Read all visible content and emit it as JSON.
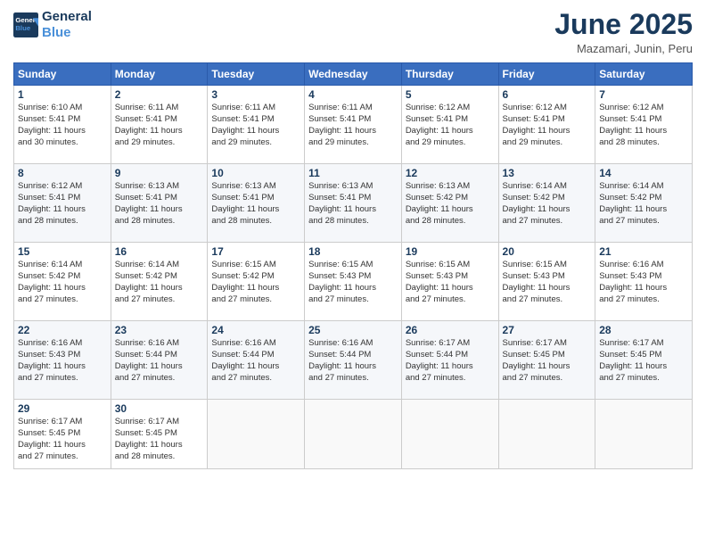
{
  "header": {
    "logo_line1": "General",
    "logo_line2": "Blue",
    "month": "June 2025",
    "location": "Mazamari, Junin, Peru"
  },
  "weekdays": [
    "Sunday",
    "Monday",
    "Tuesday",
    "Wednesday",
    "Thursday",
    "Friday",
    "Saturday"
  ],
  "weeks": [
    [
      {
        "day": "1",
        "info": "Sunrise: 6:10 AM\nSunset: 5:41 PM\nDaylight: 11 hours\nand 30 minutes."
      },
      {
        "day": "2",
        "info": "Sunrise: 6:11 AM\nSunset: 5:41 PM\nDaylight: 11 hours\nand 29 minutes."
      },
      {
        "day": "3",
        "info": "Sunrise: 6:11 AM\nSunset: 5:41 PM\nDaylight: 11 hours\nand 29 minutes."
      },
      {
        "day": "4",
        "info": "Sunrise: 6:11 AM\nSunset: 5:41 PM\nDaylight: 11 hours\nand 29 minutes."
      },
      {
        "day": "5",
        "info": "Sunrise: 6:12 AM\nSunset: 5:41 PM\nDaylight: 11 hours\nand 29 minutes."
      },
      {
        "day": "6",
        "info": "Sunrise: 6:12 AM\nSunset: 5:41 PM\nDaylight: 11 hours\nand 29 minutes."
      },
      {
        "day": "7",
        "info": "Sunrise: 6:12 AM\nSunset: 5:41 PM\nDaylight: 11 hours\nand 28 minutes."
      }
    ],
    [
      {
        "day": "8",
        "info": "Sunrise: 6:12 AM\nSunset: 5:41 PM\nDaylight: 11 hours\nand 28 minutes."
      },
      {
        "day": "9",
        "info": "Sunrise: 6:13 AM\nSunset: 5:41 PM\nDaylight: 11 hours\nand 28 minutes."
      },
      {
        "day": "10",
        "info": "Sunrise: 6:13 AM\nSunset: 5:41 PM\nDaylight: 11 hours\nand 28 minutes."
      },
      {
        "day": "11",
        "info": "Sunrise: 6:13 AM\nSunset: 5:41 PM\nDaylight: 11 hours\nand 28 minutes."
      },
      {
        "day": "12",
        "info": "Sunrise: 6:13 AM\nSunset: 5:42 PM\nDaylight: 11 hours\nand 28 minutes."
      },
      {
        "day": "13",
        "info": "Sunrise: 6:14 AM\nSunset: 5:42 PM\nDaylight: 11 hours\nand 27 minutes."
      },
      {
        "day": "14",
        "info": "Sunrise: 6:14 AM\nSunset: 5:42 PM\nDaylight: 11 hours\nand 27 minutes."
      }
    ],
    [
      {
        "day": "15",
        "info": "Sunrise: 6:14 AM\nSunset: 5:42 PM\nDaylight: 11 hours\nand 27 minutes."
      },
      {
        "day": "16",
        "info": "Sunrise: 6:14 AM\nSunset: 5:42 PM\nDaylight: 11 hours\nand 27 minutes."
      },
      {
        "day": "17",
        "info": "Sunrise: 6:15 AM\nSunset: 5:42 PM\nDaylight: 11 hours\nand 27 minutes."
      },
      {
        "day": "18",
        "info": "Sunrise: 6:15 AM\nSunset: 5:43 PM\nDaylight: 11 hours\nand 27 minutes."
      },
      {
        "day": "19",
        "info": "Sunrise: 6:15 AM\nSunset: 5:43 PM\nDaylight: 11 hours\nand 27 minutes."
      },
      {
        "day": "20",
        "info": "Sunrise: 6:15 AM\nSunset: 5:43 PM\nDaylight: 11 hours\nand 27 minutes."
      },
      {
        "day": "21",
        "info": "Sunrise: 6:16 AM\nSunset: 5:43 PM\nDaylight: 11 hours\nand 27 minutes."
      }
    ],
    [
      {
        "day": "22",
        "info": "Sunrise: 6:16 AM\nSunset: 5:43 PM\nDaylight: 11 hours\nand 27 minutes."
      },
      {
        "day": "23",
        "info": "Sunrise: 6:16 AM\nSunset: 5:44 PM\nDaylight: 11 hours\nand 27 minutes."
      },
      {
        "day": "24",
        "info": "Sunrise: 6:16 AM\nSunset: 5:44 PM\nDaylight: 11 hours\nand 27 minutes."
      },
      {
        "day": "25",
        "info": "Sunrise: 6:16 AM\nSunset: 5:44 PM\nDaylight: 11 hours\nand 27 minutes."
      },
      {
        "day": "26",
        "info": "Sunrise: 6:17 AM\nSunset: 5:44 PM\nDaylight: 11 hours\nand 27 minutes."
      },
      {
        "day": "27",
        "info": "Sunrise: 6:17 AM\nSunset: 5:45 PM\nDaylight: 11 hours\nand 27 minutes."
      },
      {
        "day": "28",
        "info": "Sunrise: 6:17 AM\nSunset: 5:45 PM\nDaylight: 11 hours\nand 27 minutes."
      }
    ],
    [
      {
        "day": "29",
        "info": "Sunrise: 6:17 AM\nSunset: 5:45 PM\nDaylight: 11 hours\nand 27 minutes."
      },
      {
        "day": "30",
        "info": "Sunrise: 6:17 AM\nSunset: 5:45 PM\nDaylight: 11 hours\nand 28 minutes."
      },
      {
        "day": "",
        "info": ""
      },
      {
        "day": "",
        "info": ""
      },
      {
        "day": "",
        "info": ""
      },
      {
        "day": "",
        "info": ""
      },
      {
        "day": "",
        "info": ""
      }
    ]
  ]
}
